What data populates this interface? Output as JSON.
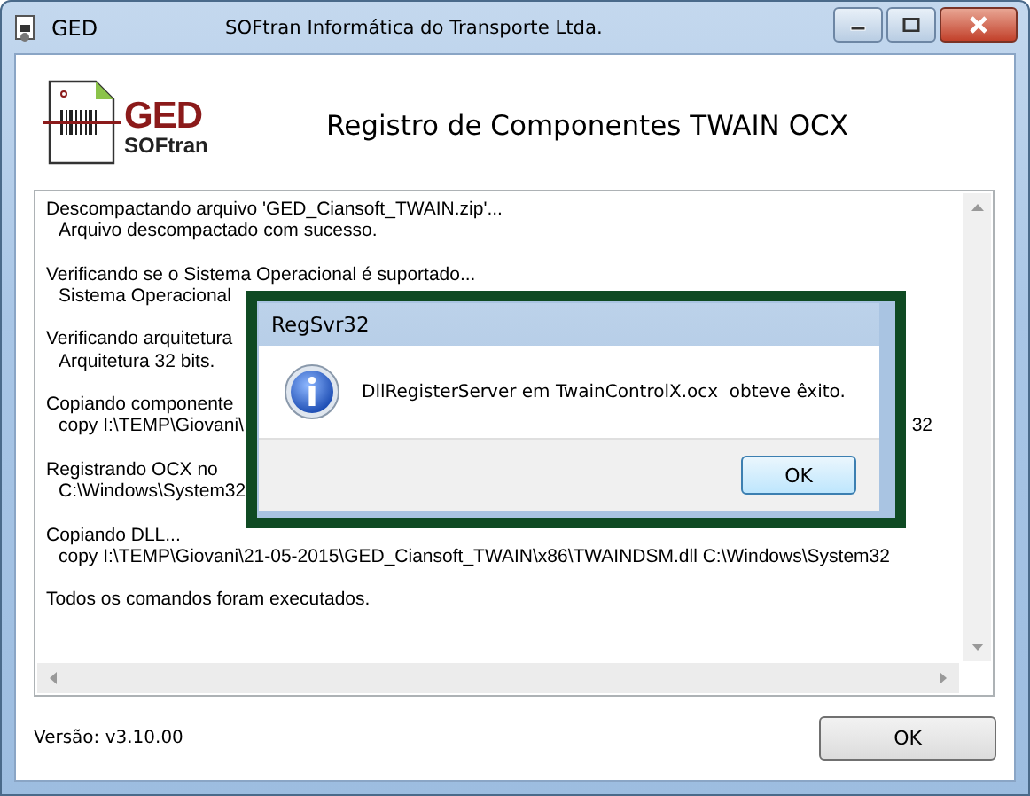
{
  "window": {
    "title": "GED",
    "subtitle": "SOFtran Informática do Transporte Ltda."
  },
  "logo": {
    "mark": "GED",
    "brand": "SOFtran"
  },
  "heading": "Registro de Componentes TWAIN OCX",
  "log": {
    "groups": [
      {
        "title": "Descompactando arquivo 'GED_Ciansoft_TWAIN.zip'...",
        "details": [
          {
            "text": "Arquivo descompactado com sucesso."
          }
        ]
      },
      {
        "title": "Verificando se o Sistema Operacional é suportado...",
        "details": [
          {
            "text": "Sistema Operacional"
          }
        ]
      },
      {
        "title": "Verificando arquitetura",
        "details": [
          {
            "text": "Arquitetura 32 bits."
          }
        ]
      },
      {
        "title": "Copiando componente",
        "details": [
          {
            "text": "copy I:\\TEMP\\Giovani\\",
            "tail": "32"
          }
        ]
      },
      {
        "title": "Registrando OCX no",
        "details": [
          {
            "text": "C:\\Windows\\System32"
          }
        ]
      },
      {
        "title": "Copiando DLL...",
        "details": [
          {
            "text": "copy I:\\TEMP\\Giovani\\21-05-2015\\GED_Ciansoft_TWAIN\\x86\\TWAINDSM.dll C:\\Windows\\System32"
          }
        ]
      },
      {
        "title": "Todos os comandos foram executados."
      }
    ]
  },
  "footer": {
    "version": "Versão: v3.10.00",
    "button": "OK"
  },
  "dialog": {
    "title": "RegSvr32",
    "message": "DllRegisterServer em TwainControlX.ocx  obteve êxito.",
    "button": "OK"
  }
}
